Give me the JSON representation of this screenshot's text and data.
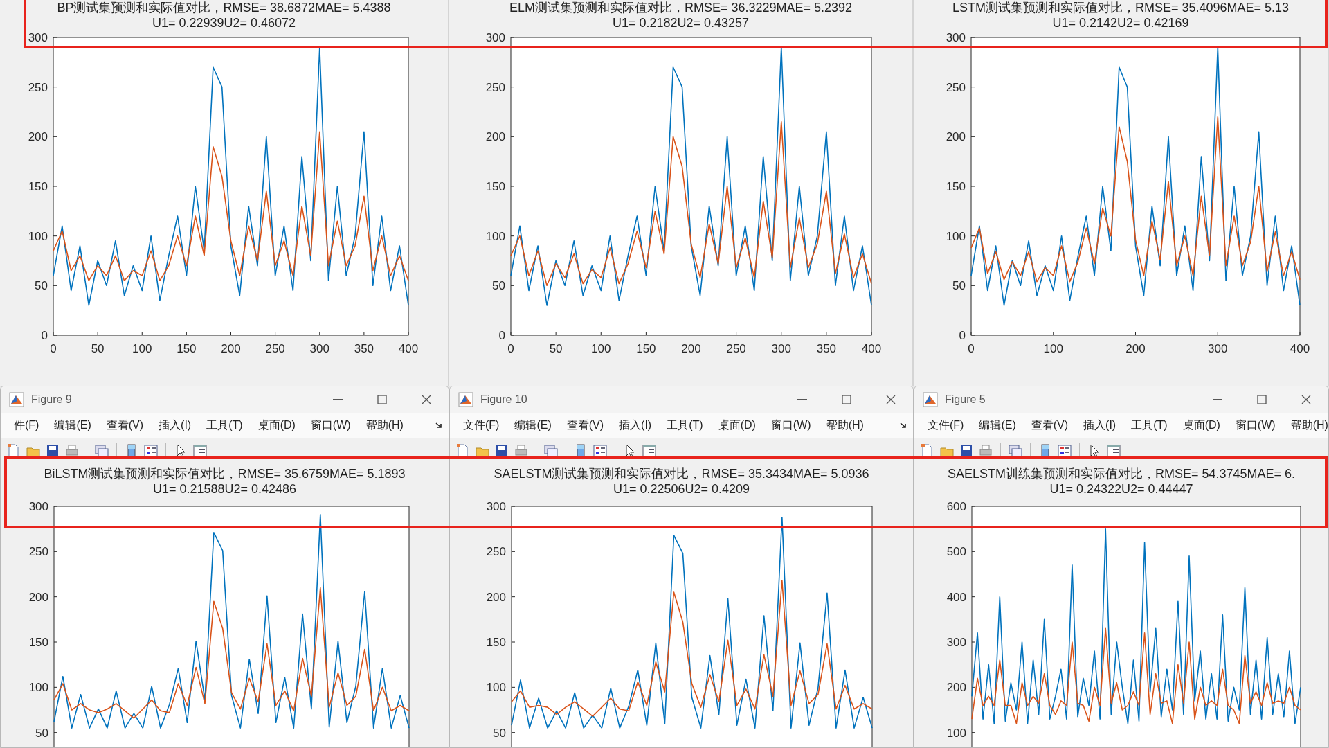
{
  "panels": [
    {
      "title_lines": [
        "BP测试集预测和实际值对比，RMSE= 38.6872MAE= 5.4388",
        "U1= 0.22939U2= 0.46072"
      ],
      "chart_data": {
        "type": "line",
        "xlim": [
          0,
          400
        ],
        "ylim": [
          0,
          300
        ],
        "xticks": [
          0,
          50,
          100,
          150,
          200,
          250,
          300,
          350,
          400
        ],
        "yticks": [
          0,
          50,
          100,
          150,
          200,
          250,
          300
        ],
        "x": [
          0,
          10,
          20,
          30,
          40,
          50,
          60,
          70,
          80,
          90,
          100,
          110,
          120,
          130,
          140,
          150,
          160,
          170,
          180,
          190,
          200,
          210,
          220,
          230,
          240,
          250,
          260,
          270,
          280,
          290,
          300,
          310,
          320,
          330,
          340,
          350,
          360,
          370,
          380,
          390,
          400
        ],
        "series": [
          {
            "color": "#0072bd",
            "values": [
              60,
              110,
              45,
              90,
              30,
              75,
              50,
              95,
              40,
              70,
              45,
              100,
              35,
              80,
              120,
              60,
              150,
              85,
              270,
              250,
              90,
              40,
              130,
              70,
              200,
              60,
              110,
              45,
              180,
              75,
              290,
              55,
              150,
              60,
              100,
              205,
              50,
              120,
              45,
              90,
              30
            ]
          },
          {
            "color": "#d95319",
            "values": [
              85,
              105,
              65,
              80,
              55,
              70,
              60,
              80,
              55,
              65,
              60,
              85,
              55,
              70,
              100,
              70,
              120,
              80,
              190,
              160,
              95,
              60,
              110,
              75,
              145,
              70,
              95,
              60,
              130,
              80,
              205,
              70,
              115,
              70,
              90,
              140,
              65,
              100,
              60,
              80,
              55
            ]
          }
        ]
      }
    },
    {
      "title_lines": [
        "ELM测试集预测和实际值对比，RMSE= 36.3229MAE= 5.2392",
        "U1= 0.2182U2= 0.43257"
      ],
      "chart_data": {
        "type": "line",
        "xlim": [
          0,
          400
        ],
        "ylim": [
          0,
          300
        ],
        "xticks": [
          0,
          50,
          100,
          150,
          200,
          250,
          300,
          350,
          400
        ],
        "yticks": [
          0,
          50,
          100,
          150,
          200,
          250,
          300
        ],
        "x": [
          0,
          10,
          20,
          30,
          40,
          50,
          60,
          70,
          80,
          90,
          100,
          110,
          120,
          130,
          140,
          150,
          160,
          170,
          180,
          190,
          200,
          210,
          220,
          230,
          240,
          250,
          260,
          270,
          280,
          290,
          300,
          310,
          320,
          330,
          340,
          350,
          360,
          370,
          380,
          390,
          400
        ],
        "series": [
          {
            "color": "#0072bd",
            "values": [
              60,
              110,
              45,
              90,
              30,
              75,
              50,
              95,
              40,
              70,
              45,
              100,
              35,
              80,
              120,
              60,
              150,
              85,
              270,
              250,
              90,
              40,
              130,
              70,
              200,
              60,
              110,
              45,
              180,
              75,
              290,
              55,
              150,
              60,
              100,
              205,
              50,
              120,
              45,
              90,
              30
            ]
          },
          {
            "color": "#d95319",
            "values": [
              80,
              100,
              60,
              85,
              50,
              72,
              58,
              82,
              52,
              66,
              58,
              88,
              52,
              72,
              105,
              68,
              125,
              82,
              200,
              170,
              92,
              58,
              112,
              72,
              150,
              68,
              98,
              58,
              135,
              78,
              215,
              68,
              118,
              68,
              92,
              145,
              62,
              102,
              58,
              82,
              52
            ]
          }
        ]
      }
    },
    {
      "title_lines": [
        "LSTM测试集预测和实际值对比，RMSE= 35.4096MAE= 5.13",
        "U1= 0.2142U2= 0.42169"
      ],
      "chart_data": {
        "type": "line",
        "xlim": [
          0,
          400
        ],
        "ylim": [
          0,
          300
        ],
        "xticks": [
          0,
          100,
          200,
          300,
          400
        ],
        "yticks": [
          0,
          50,
          100,
          150,
          200,
          250,
          300
        ],
        "x": [
          0,
          10,
          20,
          30,
          40,
          50,
          60,
          70,
          80,
          90,
          100,
          110,
          120,
          130,
          140,
          150,
          160,
          170,
          180,
          190,
          200,
          210,
          220,
          230,
          240,
          250,
          260,
          270,
          280,
          290,
          300,
          310,
          320,
          330,
          340,
          350,
          360,
          370,
          380,
          390,
          400
        ],
        "series": [
          {
            "color": "#0072bd",
            "values": [
              60,
              110,
              45,
              90,
              30,
              75,
              50,
              95,
              40,
              70,
              45,
              100,
              35,
              80,
              120,
              60,
              150,
              85,
              270,
              250,
              90,
              40,
              130,
              70,
              200,
              60,
              110,
              45,
              180,
              75,
              290,
              55,
              150,
              60,
              100,
              205,
              50,
              120,
              45,
              90,
              30
            ]
          },
          {
            "color": "#d95319",
            "values": [
              88,
              108,
              62,
              84,
              56,
              74,
              60,
              84,
              54,
              68,
              60,
              90,
              54,
              74,
              108,
              72,
              128,
              100,
              210,
              175,
              96,
              60,
              115,
              76,
              155,
              70,
              100,
              60,
              140,
              80,
              220,
              70,
              120,
              70,
              94,
              150,
              64,
              104,
              60,
              84,
              56
            ]
          }
        ]
      }
    }
  ],
  "windows": [
    {
      "title": "Figure 9",
      "menu": [
        "件(F)",
        "编辑(E)",
        "查看(V)",
        "插入(I)",
        "工具(T)",
        "桌面(D)",
        "窗口(W)",
        "帮助(H)"
      ],
      "title_lines": [
        "BiLSTM测试集预测和实际值对比，RMSE= 35.6759MAE= 5.1893",
        "U1= 0.21588U2= 0.42486"
      ],
      "chart_data": {
        "type": "line",
        "xlim": [
          0,
          400
        ],
        "ylim": [
          0,
          300
        ],
        "yticks": [
          50,
          100,
          150,
          200,
          250,
          300
        ],
        "x": [
          0,
          10,
          20,
          30,
          40,
          50,
          60,
          70,
          80,
          90,
          100,
          110,
          120,
          130,
          140,
          150,
          160,
          170,
          180,
          190,
          200,
          210,
          220,
          230,
          240,
          250,
          260,
          270,
          280,
          290,
          300,
          310,
          320,
          330,
          340,
          350,
          360,
          370,
          380,
          390,
          400
        ],
        "series": [
          {
            "color": "#0072bd",
            "values": [
              62,
              112,
              55,
              92,
              55,
              76,
              55,
              96,
              55,
              71,
              55,
              101,
              55,
              81,
              121,
              61,
              151,
              86,
              271,
              251,
              91,
              55,
              131,
              71,
              201,
              61,
              111,
              55,
              181,
              76,
              291,
              56,
              151,
              61,
              101,
              206,
              55,
              121,
              55,
              91,
              55
            ]
          },
          {
            "color": "#d95319",
            "values": [
              86,
              104,
              75,
              82,
              75,
              72,
              76,
              82,
              74,
              66,
              76,
              86,
              74,
              72,
              104,
              80,
              122,
              82,
              195,
              165,
              94,
              76,
              110,
              84,
              148,
              80,
              96,
              74,
              132,
              90,
              210,
              78,
              116,
              80,
              90,
              142,
              74,
              100,
              74,
              80,
              74
            ]
          }
        ]
      }
    },
    {
      "title": "Figure 10",
      "menu": [
        "文件(F)",
        "编辑(E)",
        "查看(V)",
        "插入(I)",
        "工具(T)",
        "桌面(D)",
        "窗口(W)",
        "帮助(H)"
      ],
      "title_lines": [
        "SAELSTM测试集预测和实际值对比，RMSE= 35.3434MAE= 5.0936",
        "U1= 0.22506U2= 0.4209"
      ],
      "chart_data": {
        "type": "line",
        "xlim": [
          0,
          400
        ],
        "ylim": [
          0,
          300
        ],
        "yticks": [
          50,
          100,
          150,
          200,
          250,
          300
        ],
        "x": [
          0,
          10,
          20,
          30,
          40,
          50,
          60,
          70,
          80,
          90,
          100,
          110,
          120,
          130,
          140,
          150,
          160,
          170,
          180,
          190,
          200,
          210,
          220,
          230,
          240,
          250,
          260,
          270,
          280,
          290,
          300,
          310,
          320,
          330,
          340,
          350,
          360,
          370,
          380,
          390,
          400
        ],
        "series": [
          {
            "color": "#0072bd",
            "values": [
              58,
              108,
              55,
              88,
              55,
              74,
              55,
              94,
              55,
              69,
              55,
              99,
              55,
              79,
              119,
              58,
              149,
              60,
              268,
              248,
              89,
              55,
              135,
              70,
              198,
              58,
              109,
              55,
              179,
              74,
              288,
              55,
              149,
              58,
              99,
              204,
              55,
              119,
              55,
              89,
              55
            ]
          },
          {
            "color": "#d95319",
            "values": [
              84,
              96,
              78,
              80,
              78,
              70,
              78,
              84,
              76,
              68,
              78,
              88,
              76,
              74,
              106,
              80,
              128,
              95,
              205,
              172,
              104,
              78,
              114,
              84,
              152,
              80,
              98,
              76,
              136,
              90,
              218,
              80,
              118,
              82,
              92,
              148,
              76,
              102,
              76,
              82,
              76
            ]
          }
        ]
      }
    },
    {
      "title": "Figure 5",
      "menu": [
        "文件(F)",
        "编辑(E)",
        "查看(V)",
        "插入(I)",
        "工具(T)",
        "桌面(D)",
        "窗口(W)",
        "帮助(H)"
      ],
      "title_lines": [
        "SAELSTM训练集预测和实际值对比，RMSE= 54.3745MAE= 6.",
        "U1= 0.24322U2= 0.44447"
      ],
      "chart_data": {
        "type": "line",
        "ylim": [
          0,
          600
        ],
        "yticks": [
          100,
          200,
          300,
          400,
          500,
          600
        ],
        "series": [
          {
            "color": "#0072bd",
            "values": [
              180,
              320,
              130,
              250,
              120,
              400,
              125,
              210,
              150,
              300,
              120,
              260,
              140,
              350,
              130,
              180,
              240,
              130,
              470,
              135,
              220,
              160,
              280,
              130,
              550,
              140,
              300,
              200,
              120,
              260,
              125,
              520,
              190,
              330,
              135,
              240,
              150,
              390,
              140,
              490,
              170,
              280,
              130,
              230,
              130,
              360,
              125,
              200,
              150,
              420,
              140,
              260,
              130,
              310,
              140,
              230,
              135,
              280,
              120,
              200
            ]
          },
          {
            "color": "#d95319",
            "values": [
              130,
              220,
              160,
              180,
              160,
              260,
              160,
              160,
              120,
              210,
              160,
              180,
              165,
              230,
              160,
              140,
              170,
              160,
              300,
              165,
              160,
              125,
              200,
              160,
              330,
              165,
              210,
              150,
              160,
              190,
              160,
              320,
              140,
              230,
              165,
              170,
              120,
              250,
              165,
              300,
              130,
              200,
              160,
              170,
              160,
              240,
              160,
              150,
              120,
              270,
              165,
              190,
              160,
              210,
              165,
              170,
              165,
              200,
              160,
              150
            ]
          }
        ]
      }
    }
  ]
}
